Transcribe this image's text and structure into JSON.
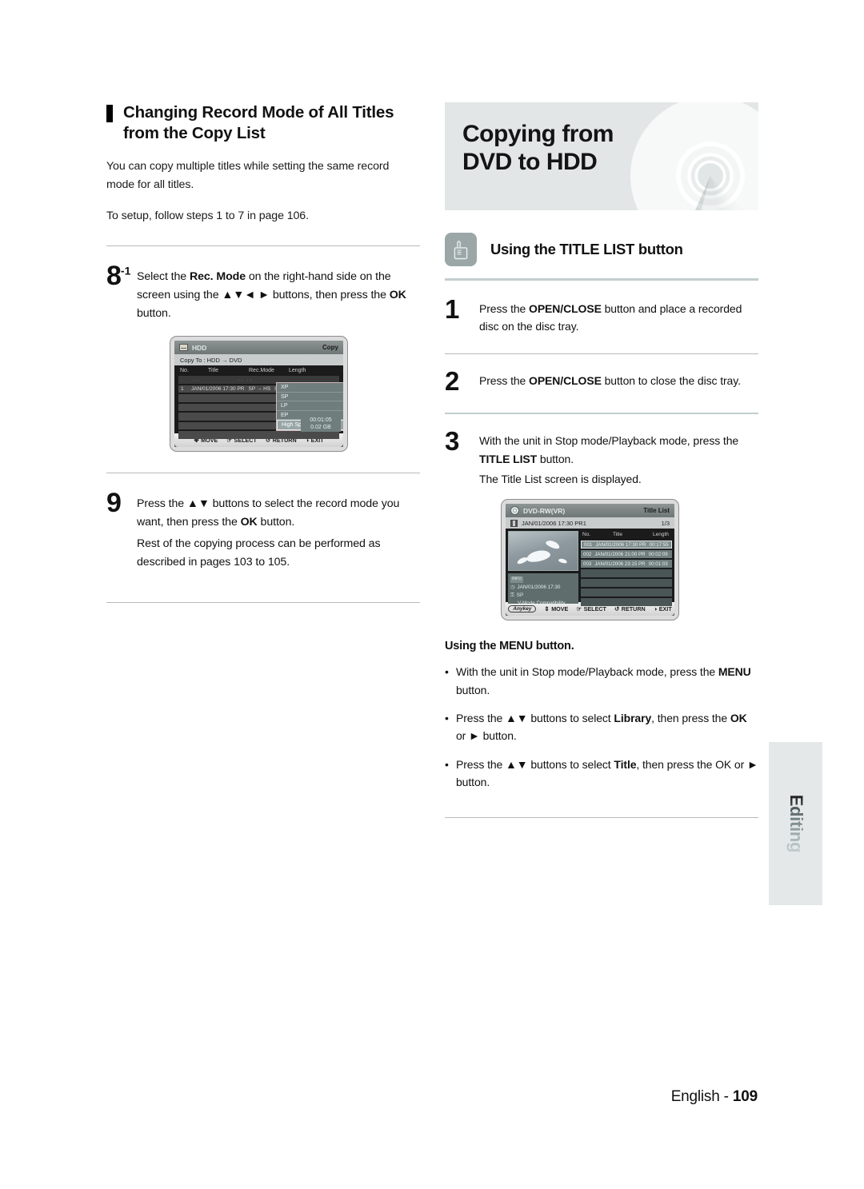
{
  "left": {
    "heading": "Changing Record Mode of All Titles from the Copy List",
    "intro": "You can copy multiple titles while setting the same record mode for all titles.",
    "setup_note": "To setup, follow steps 1 to 7 in page 106.",
    "step8": {
      "number": "8",
      "sub": "-1",
      "line1_a": "Select the ",
      "line1_b": "Rec. Mode",
      "line1_c": " on the right-hand side on the screen using the ",
      "arrows": "▲▼◄ ►",
      "line1_d": " buttons, then press the ",
      "line1_e": "OK",
      "line1_f": " button."
    },
    "step9": {
      "number": "9",
      "a": "Press the ",
      "arrows": "▲▼",
      "b": " buttons to select the record mode you want, then press the ",
      "c": "OK",
      "d": " button.",
      "e": "Rest of the copying process can be performed as described in pages 103 to 105."
    },
    "copy_screen": {
      "device": "HDD",
      "mode_label": "Copy",
      "copy_to": "Copy To : HDD  →  DVD",
      "columns": [
        "No.",
        "Title",
        "Rec.Mode",
        "Length"
      ],
      "rows": [
        {
          "no": "1",
          "title": "JAN/01/2006 17:30 PR",
          "recmode": "SP → HS",
          "length": "01:"
        }
      ],
      "dropdown": {
        "items": [
          "XP",
          "SP",
          "LP",
          "EP"
        ],
        "selected": "High Speed",
        "check": "✓"
      },
      "size": {
        "time": "00:01:05",
        "bytes": "0.02 GB"
      },
      "footer": [
        {
          "icon": "dpad-icon",
          "label": "MOVE"
        },
        {
          "icon": "select-icon",
          "label": "SELECT"
        },
        {
          "icon": "return-icon",
          "label": "RETURN"
        },
        {
          "icon": "exit-icon",
          "label": "EXIT"
        }
      ]
    }
  },
  "right": {
    "banner_title": "Copying from DVD to HDD",
    "subsection_title": "Using the TITLE LIST button",
    "steps": [
      {
        "number": "1",
        "a": "Press the ",
        "b": "OPEN/CLOSE",
        "c": " button and place a recorded disc on the disc tray.",
        "extra": ""
      },
      {
        "number": "2",
        "a": "Press the ",
        "b": "OPEN/CLOSE",
        "c": " button to close the disc tray.",
        "extra": ""
      },
      {
        "number": "3",
        "a": "With the unit in Stop mode/Playback mode, press the ",
        "b": "TITLE LIST",
        "c": " button.",
        "extra": "The Title List screen is displayed."
      }
    ],
    "title_list_screen": {
      "disc_type": "DVD-RW(VR)",
      "screen_name": "Title List",
      "current_title": "JAN/01/2006 17:30 PR1",
      "page_indicator": "1/3",
      "columns": [
        "No.",
        "Title",
        "Length"
      ],
      "rows": [
        {
          "no": "001",
          "title": "JAN/01/2006 17:30 PR",
          "length": "00:17:55"
        },
        {
          "no": "002",
          "title": "JAN/01/2006 21:00 PR",
          "length": "00:02:09"
        },
        {
          "no": "003",
          "title": "JAN/01/2006 23:15 PR",
          "length": "00:01:03"
        }
      ],
      "info": {
        "badge": "INFO",
        "date": "JAN/01/2006 17:30",
        "rec_mode": "SP",
        "compat": "V-Mode Compatibility"
      },
      "footer": [
        {
          "icon": "anykey-icon",
          "label": "Anykey"
        },
        {
          "icon": "updown-icon",
          "label": "MOVE"
        },
        {
          "icon": "select-icon",
          "label": "SELECT"
        },
        {
          "icon": "return-icon",
          "label": "RETURN"
        },
        {
          "icon": "exit-icon",
          "label": "EXIT"
        }
      ]
    },
    "menu_section": {
      "heading": "Using the MENU button.",
      "bullets": [
        {
          "a": "With the unit in Stop mode/Playback mode, press the ",
          "b": "MENU",
          "c": " button.",
          "arrows": "",
          "d": "",
          "e": ""
        },
        {
          "a": "Press the ",
          "arrows": "▲▼",
          "b2": " buttons to select ",
          "b": "Library",
          "c": ", then press the ",
          "d": "OK",
          "e": " or ► button."
        },
        {
          "a": "Press the ",
          "arrows": "▲▼",
          "b2": " buttons to select ",
          "b": "Title",
          "c": ", then press the OK or ► button.",
          "d": "",
          "e": ""
        }
      ]
    }
  },
  "footer": {
    "language": "English - ",
    "page": "109"
  },
  "side_tab": {
    "label": "Editing"
  },
  "colors": {
    "banner_bg": "#e2e6e6",
    "icon_box": "#9ba7a7",
    "rule": "#b9b9b9",
    "screen_panel": "#6f7d7d",
    "dropdown_border": "#d3b5b8",
    "side_tab_bg": "#e4e8e8"
  }
}
